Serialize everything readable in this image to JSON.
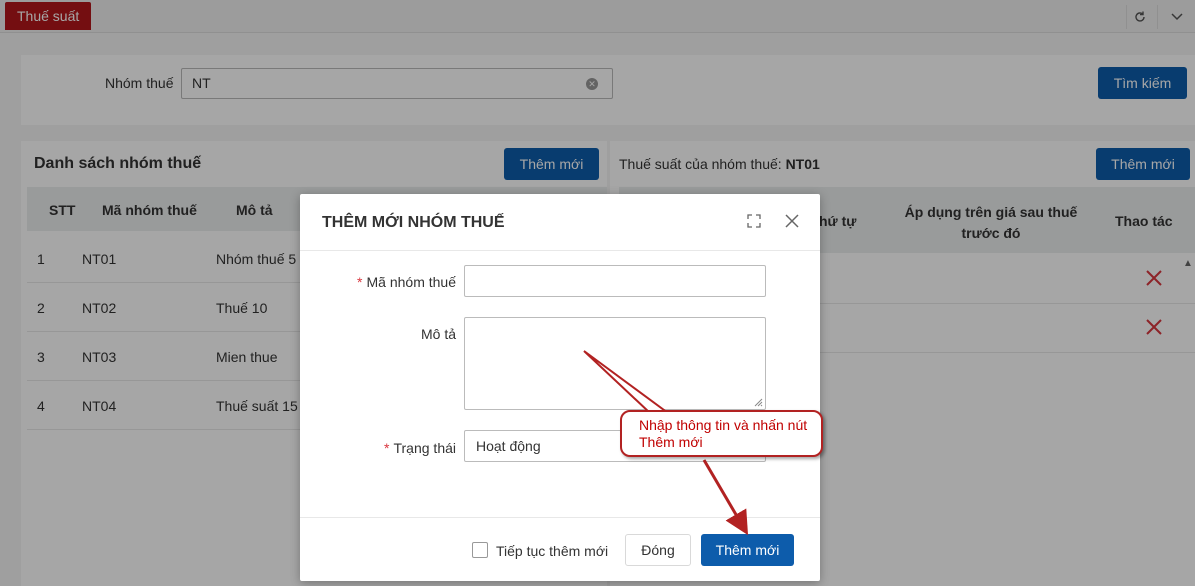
{
  "topbar": {
    "active_tab": "Thuế suất"
  },
  "search": {
    "label": "Nhóm thuế",
    "value": "NT",
    "button": "Tìm kiếm"
  },
  "left": {
    "title": "Danh sách nhóm thuế",
    "add_button": "Thêm mới",
    "columns": [
      "STT",
      "Mã nhóm thuế",
      "Mô tả"
    ],
    "rows": [
      {
        "stt": "1",
        "code": "NT01",
        "desc": "Nhóm thuế 5"
      },
      {
        "stt": "2",
        "code": "NT02",
        "desc": "Thuế 10"
      },
      {
        "stt": "3",
        "code": "NT03",
        "desc": "Mien thue"
      },
      {
        "stt": "4",
        "code": "NT04",
        "desc": "Thuế suất 15"
      }
    ]
  },
  "right": {
    "title_prefix": "Thuế suất của nhóm thuế:",
    "title_code": "NT01",
    "add_button": "Thêm mới",
    "columns": [
      "hứ tự",
      "Áp dụng trên giá sau thuế trước đó",
      "Thao tác"
    ]
  },
  "modal": {
    "title": "THÊM MỚI NHÓM THUẾ",
    "fields": {
      "code_label": "Mã nhóm thuế",
      "code_value": "",
      "desc_label": "Mô tả",
      "desc_value": "",
      "status_label": "Trạng thái",
      "status_value": "Hoạt động"
    },
    "required_mark": "*",
    "continue_label": "Tiếp tục thêm mới",
    "close_button": "Đóng",
    "submit_button": "Thêm mới"
  },
  "annotation": {
    "text": "Nhập thông tin và nhấn nút Thêm mới",
    "color": "#c00000"
  },
  "colors": {
    "brand": "#b3161b",
    "primary": "#0d5cab",
    "danger": "#d9363e"
  }
}
